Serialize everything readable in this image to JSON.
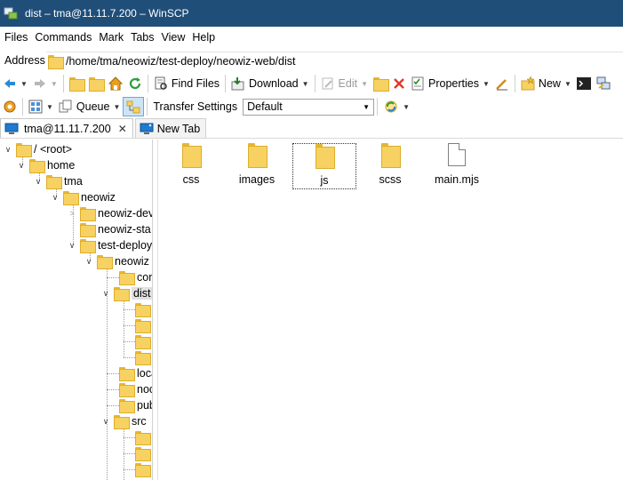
{
  "window": {
    "title": "dist – tma@11.11.7.200 – WinSCP"
  },
  "menu": [
    "Files",
    "Commands",
    "Mark",
    "Tabs",
    "View",
    "Help"
  ],
  "address": {
    "label": "Address",
    "path": "/home/tma/neowiz/test-deploy/neowiz-web/dist"
  },
  "toolbar1": {
    "find_files": "Find Files",
    "download": "Download",
    "edit": "Edit",
    "properties": "Properties",
    "new": "New"
  },
  "toolbar2": {
    "queue": "Queue",
    "transfer_settings_label": "Transfer Settings",
    "transfer_settings_value": "Default"
  },
  "tabs": {
    "session": "tma@11.11.7.200",
    "new_tab": "New Tab"
  },
  "tree": {
    "root": "/ <root>",
    "home": "home",
    "tma": "tma",
    "neowiz": "neowiz",
    "neowiz_dev": "neowiz-dev",
    "neowiz_sta": "neowiz-sta",
    "test_deploy": "test-deploy",
    "neowiz_web": "neowiz",
    "con": "con",
    "dist": "dist",
    "local": "loca",
    "node": "noc",
    "pub": "pub",
    "src": "src"
  },
  "files": [
    {
      "name": "css",
      "type": "folder"
    },
    {
      "name": "images",
      "type": "folder"
    },
    {
      "name": "js",
      "type": "folder"
    },
    {
      "name": "scss",
      "type": "folder"
    },
    {
      "name": "main.mjs",
      "type": "file"
    }
  ],
  "colors": {
    "titlebar": "#1f4e79",
    "folder": "#f7d262"
  }
}
